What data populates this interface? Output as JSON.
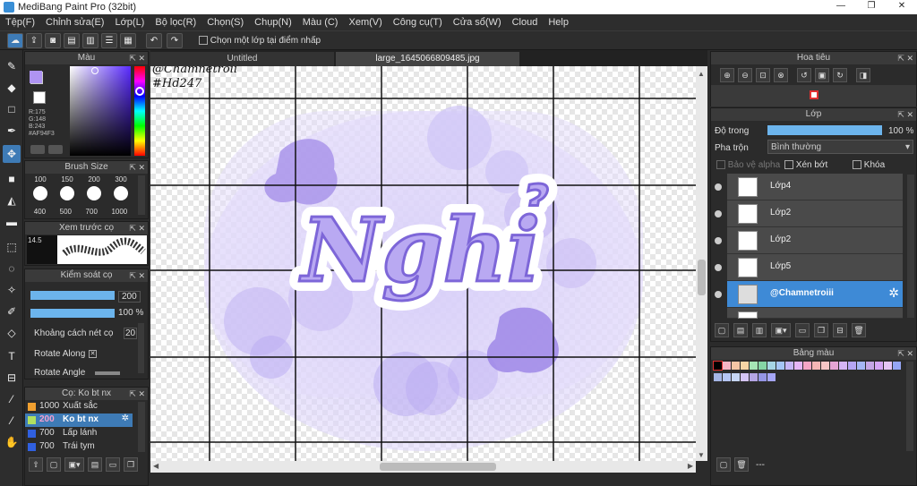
{
  "window": {
    "title": "MediBang Paint Pro (32bit)",
    "minimize": "—",
    "maximize": "❐",
    "close": "✕"
  },
  "menu": [
    "Tệp(F)",
    "Chỉnh sửa(E)",
    "Lớp(L)",
    "Bộ lọc(R)",
    "Chọn(S)",
    "Chụp(N)",
    "Màu (C)",
    "Xem(V)",
    "Công cụ(T)",
    "Cửa sổ(W)",
    "Cloud",
    "Help"
  ],
  "toolbar": {
    "sample_merged_label": "Chọn một lớp tại điểm nhấp"
  },
  "color_panel": {
    "title": "Màu",
    "r": "R:175",
    "g": "G:148",
    "b": "B:243",
    "hex": "#AF94F3",
    "primary": "#af94f3",
    "secondary": "#ffffff"
  },
  "brush_size": {
    "title": "Brush Size",
    "sizes_top": [
      "100",
      "150",
      "200",
      "300"
    ],
    "sizes_bottom": [
      "400",
      "500",
      "700",
      "1000"
    ]
  },
  "brush_preview": {
    "title": "Xem trước cọ",
    "size_label": "14.5"
  },
  "brush_control": {
    "title": "Kiểm soát cọ",
    "size_value": "200",
    "opacity_value": "100 %",
    "spacing_label": "Khoảng cách nét cọ",
    "spacing_value": "20",
    "rotate_along_label": "Rotate Along",
    "rotate_angle_label": "Rotate Angle"
  },
  "brush_list": {
    "title": "Cọ: Ko bt nx",
    "items": [
      {
        "size": "1000",
        "name": "Xuất sắc",
        "color": "#f0a030"
      },
      {
        "size": "200",
        "name": "Ko bt nx",
        "color": "#b0e060"
      },
      {
        "size": "700",
        "name": "Lấp lánh",
        "color": "#3060e0"
      },
      {
        "size": "700",
        "name": "Trái tym",
        "color": "#3060e0"
      }
    ]
  },
  "tabs": [
    "Untitled",
    "large_1645066809485.jpg"
  ],
  "canvas": {
    "watermark_line1": "@Chamnetroii",
    "watermark_line2": "#Hd247",
    "art_text": "Nghỉ"
  },
  "navigator": {
    "title": "Hoa tiêu"
  },
  "layer_panel": {
    "title": "Lớp",
    "opacity_label": "Độ trong",
    "opacity_value": "100 %",
    "blend_label": "Pha trộn",
    "blend_value": "Bình thường",
    "protect_alpha": "Bảo vệ alpha",
    "clipping": "Xén bớt",
    "lock": "Khóa",
    "layers": [
      "Lớp4",
      "Lớp2",
      "Lớp2",
      "Lớp5",
      "@Chamnetroiii"
    ]
  },
  "palette_panel": {
    "title": "Bảng màu",
    "footer": "---",
    "colors": [
      "#000000",
      "#f5b5c5",
      "#f5c5a5",
      "#f5d5a5",
      "#a5e5b5",
      "#85d5a5",
      "#a5d5e5",
      "#a5c5f5",
      "#c5b5f5",
      "#e5b5f5",
      "#f5a5c5",
      "#f5b5b5",
      "#f5c5c5",
      "#e5a5d5",
      "#d5b5f5",
      "#b5a5f5",
      "#a5b5f5",
      "#c5a5e5",
      "#d5a5f5",
      "#e5c5f5",
      "#95a5f5",
      "#a5b5e5",
      "#b5c5f5",
      "#c5d5f5",
      "#d5c5f5",
      "#b5a5e5",
      "#9595e5",
      "#a5a5f5"
    ]
  }
}
